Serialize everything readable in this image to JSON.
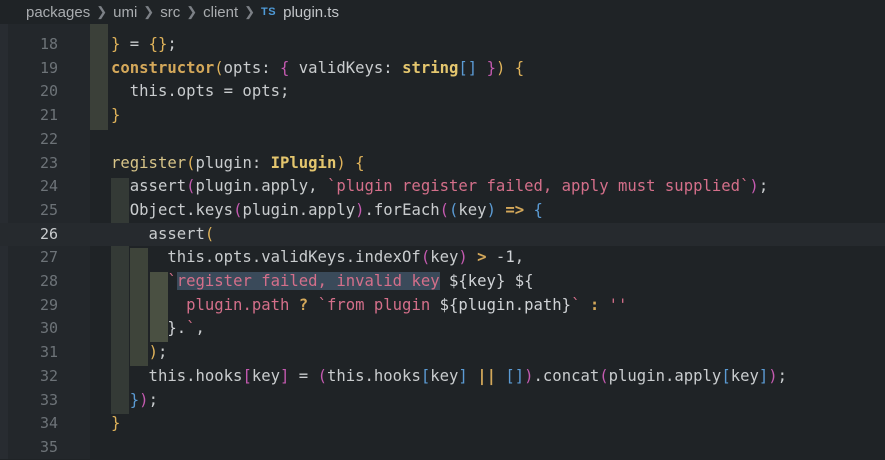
{
  "breadcrumb": {
    "segments": [
      "packages",
      "umi",
      "src",
      "client"
    ],
    "file_icon": "TS",
    "file": "plugin.ts"
  },
  "editor": {
    "lines": [
      {
        "n": "18",
        "html": "<span class=\"pb1\">}</span> = <span class=\"pb1\">{}</span>;"
      },
      {
        "n": "19",
        "html": "<span class=\"kw\">constructor</span><span class=\"pb1\">(</span>opts: <span class=\"pb2\">{</span> validKeys: <span class=\"ty\">string</span><span class=\"pb3\">[]</span> <span class=\"pb2\">}</span><span class=\"pb1\">)</span> <span class=\"pb1\">{</span>"
      },
      {
        "n": "20",
        "html": "  this.opts = opts;"
      },
      {
        "n": "21",
        "html": "<span class=\"pb1\">}</span>"
      },
      {
        "n": "22",
        "html": ""
      },
      {
        "n": "23",
        "html": "<span class=\"fn\">register</span><span class=\"pb1\">(</span>plugin: <span class=\"ty\">IPlugin</span><span class=\"pb1\">)</span> <span class=\"pb1\">{</span>"
      },
      {
        "n": "24",
        "html": "  assert<span class=\"pb2\">(</span>plugin.apply, <span class=\"str\">`plugin register failed, apply must supplied`</span><span class=\"pb2\">)</span>;"
      },
      {
        "n": "25",
        "html": "  Object.keys<span class=\"pb2\">(</span>plugin.apply<span class=\"pb2\">)</span>.forEach<span class=\"pb2\">(</span><span class=\"pb3\">(</span>key<span class=\"pb3\">)</span> <span class=\"kw\">=&gt;</span> <span class=\"pb3\">{</span>"
      },
      {
        "n": "26",
        "html": "    assert<span class=\"pb1\">(</span>"
      },
      {
        "n": "27",
        "html": "      this.opts.validKeys.indexOf<span class=\"pb2\">(</span>key<span class=\"pb2\">)</span> <span class=\"kw\">&gt;</span> -<span class=\"num\">1</span>,"
      },
      {
        "n": "28",
        "html": "      <span class=\"str\">`</span><span class=\"str sel\">register failed, invalid key</span><span class=\"tmpl\"> ${key} ${</span>"
      },
      {
        "n": "29",
        "html": "        <span class=\"str\">plugin.path</span> <span class=\"kw\">?</span> <span class=\"str\">`from plugin</span> <span class=\"tmpl\">${plugin.path}</span><span class=\"str\">`</span> <span class=\"kw\">:</span> <span class=\"str\">''</span>"
      },
      {
        "n": "30",
        "html": "      <span class=\"tmpl\">}.</span><span class=\"str\">`</span>,"
      },
      {
        "n": "31",
        "html": "    <span class=\"pb1\">)</span>;"
      },
      {
        "n": "32",
        "html": "    this.hooks<span class=\"pb2\">[</span>key<span class=\"pb2\">]</span> = <span class=\"pb2\">(</span>this.hooks<span class=\"pb3\">[</span>key<span class=\"pb3\">]</span> <span class=\"kw\">||</span> <span class=\"pb3\">[]</span><span class=\"pb2\">)</span>.concat<span class=\"pb2\">(</span>plugin.apply<span class=\"pb3\">[</span>key<span class=\"pb3\">]</span><span class=\"pb2\">)</span>;"
      },
      {
        "n": "33",
        "html": "  <span class=\"pb3\">}</span><span class=\"pb2\">)</span>;"
      },
      {
        "n": "34",
        "html": "<span class=\"pb1\">}</span>"
      },
      {
        "n": "35",
        "html": ""
      }
    ]
  }
}
